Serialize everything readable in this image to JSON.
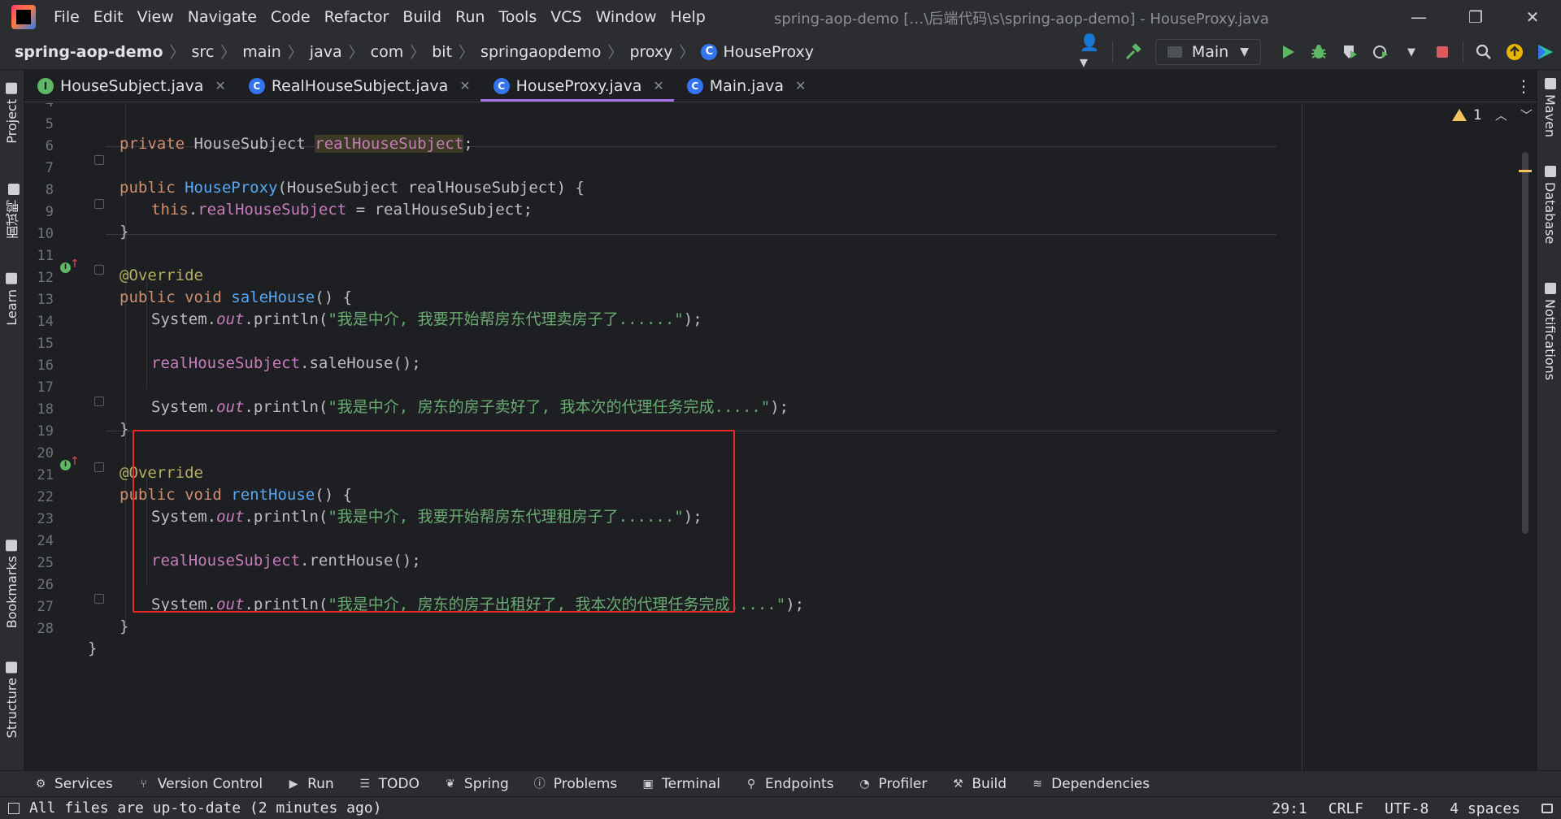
{
  "window": {
    "title": "spring-aop-demo […\\后端代码\\s\\spring-aop-demo] - HouseProxy.java",
    "minimize": "—",
    "restore": "❐",
    "close": "✕"
  },
  "menu": [
    "File",
    "Edit",
    "View",
    "Navigate",
    "Code",
    "Refactor",
    "Build",
    "Run",
    "Tools",
    "VCS",
    "Window",
    "Help"
  ],
  "breadcrumb": [
    "spring-aop-demo",
    "src",
    "main",
    "java",
    "com",
    "bit",
    "springaopdemo",
    "proxy",
    "HouseProxy"
  ],
  "toolbar": {
    "run_config": "Main",
    "icons": [
      "user-icon",
      "build-hammer-icon",
      "run-icon",
      "debug-icon",
      "coverage-icon",
      "profile-icon",
      "stop-icon",
      "search-icon",
      "update-icon",
      "plugin-icon"
    ]
  },
  "tabs": [
    {
      "label": "HouseSubject.java",
      "kind": "interface",
      "badge": "I"
    },
    {
      "label": "RealHouseSubject.java",
      "kind": "class",
      "badge": "C"
    },
    {
      "label": "HouseProxy.java",
      "kind": "class",
      "badge": "C",
      "active": true
    },
    {
      "label": "Main.java",
      "kind": "class",
      "badge": "C"
    }
  ],
  "inspection": {
    "warnings": "1"
  },
  "left_tools": [
    "Project",
    "面试鸭",
    "Learn",
    "Bookmarks",
    "Structure"
  ],
  "right_tools": [
    "Maven",
    "Database",
    "Notifications"
  ],
  "code_lines": [
    {
      "n": "4"
    },
    {
      "n": "5"
    },
    {
      "n": "6"
    },
    {
      "n": "7"
    },
    {
      "n": "8"
    },
    {
      "n": "9"
    },
    {
      "n": "10"
    },
    {
      "n": "11"
    },
    {
      "n": "12"
    },
    {
      "n": "13"
    },
    {
      "n": "14"
    },
    {
      "n": "15"
    },
    {
      "n": "16"
    },
    {
      "n": "17"
    },
    {
      "n": "18"
    },
    {
      "n": "19"
    },
    {
      "n": "20"
    },
    {
      "n": "21"
    },
    {
      "n": "22"
    },
    {
      "n": "23"
    },
    {
      "n": "24"
    },
    {
      "n": "25"
    },
    {
      "n": "26"
    },
    {
      "n": "27"
    },
    {
      "n": "28"
    }
  ],
  "code": {
    "l5_private": "private",
    "l5_type": "HouseSubject",
    "l5_field": "realHouseSubject",
    "l5_end": ";",
    "l7_public": "public",
    "l7_ctor": "HouseProxy",
    "l7_params": "(HouseSubject realHouseSubject) {",
    "l8_this": "this",
    "l8_dot": ".",
    "l8_field": "realHouseSubject",
    "l8_rest": " = realHouseSubject;",
    "brace_close": "}",
    "override": "@Override",
    "public_void": "public void",
    "sale_name": "saleHouse",
    "sig_rest": "() {",
    "sys": "System.",
    "out": "out",
    "println": ".println(",
    "l13_str": "\"我是中介, 我要开始帮房东代理卖房子了......\"",
    "stmt_end": ");",
    "field_ref": "realHouseSubject",
    "l15_call": ".saleHouse();",
    "l17_str": "\"我是中介, 房东的房子卖好了, 我本次的代理任务完成.....\"",
    "rent_name": "rentHouse",
    "l22_str": "\"我是中介, 我要开始帮房东代理租房子了......\"",
    "l24_call": ".rentHouse();",
    "l26_str": "\"我是中介, 房东的房子出租好了, 我本次的代理任务完成.....\""
  },
  "bottom_tools": [
    "Services",
    "Version Control",
    "Run",
    "TODO",
    "Spring",
    "Problems",
    "Terminal",
    "Endpoints",
    "Profiler",
    "Build",
    "Dependencies"
  ],
  "status": {
    "message": "All files are up-to-date (2 minutes ago)",
    "position": "29:1",
    "line_sep": "CRLF",
    "encoding": "UTF-8",
    "indent": "4 spaces"
  },
  "colors": {
    "accent_tab": "#a571e6",
    "highlight_box": "#e8292c",
    "keyword": "#cf8e6d",
    "string": "#6aab73",
    "field": "#c77dbb",
    "method": "#56a8f5",
    "annotation": "#b3ae60"
  }
}
